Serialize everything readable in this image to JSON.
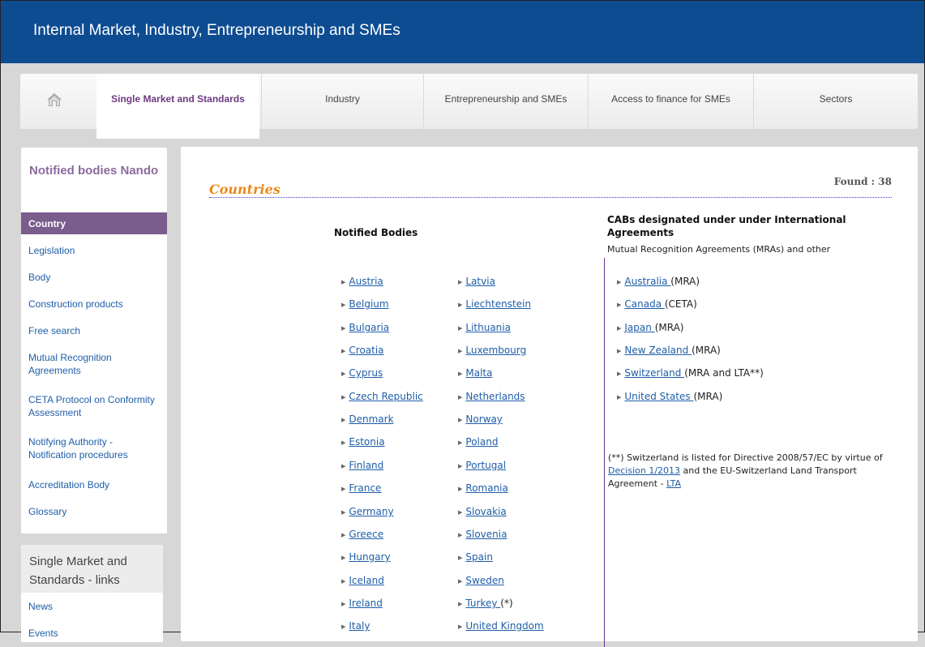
{
  "header": {
    "title": "Internal Market, Industry, Entrepreneurship and SMEs"
  },
  "nav": {
    "home_icon": "home-icon",
    "items": [
      {
        "label": "Single Market and Standards",
        "active": true
      },
      {
        "label": "Industry"
      },
      {
        "label": "Entrepreneurship and SMEs"
      },
      {
        "label": "Access to finance for SMEs"
      },
      {
        "label": "Sectors"
      }
    ]
  },
  "sidebar": {
    "title": "Notified bodies Nando",
    "items": [
      {
        "label": "Country",
        "active": true
      },
      {
        "label": "Legislation"
      },
      {
        "label": "Body"
      },
      {
        "label": "Construction products"
      },
      {
        "label": "Free search"
      },
      {
        "label": "Mutual Recognition Agreements"
      },
      {
        "label": "CETA Protocol on Conformity Assessment"
      },
      {
        "label": "Notifying Authority - Notification procedures"
      },
      {
        "label": "Accreditation Body"
      },
      {
        "label": "Glossary"
      }
    ],
    "links_box": {
      "title": "Single Market and Standards - links",
      "items": [
        {
          "label": "News"
        },
        {
          "label": "Events"
        }
      ]
    }
  },
  "main": {
    "heading": "Countries",
    "found": "Found : 38",
    "notified_bodies_header": "Notified Bodies",
    "col1": [
      "Austria",
      "Belgium",
      "Bulgaria",
      "Croatia",
      "Cyprus",
      "Czech Republic",
      "Denmark",
      "Estonia",
      "Finland",
      "France",
      "Germany",
      "Greece",
      "Hungary",
      "Iceland",
      "Ireland",
      "Italy"
    ],
    "col2": [
      "Latvia",
      "Liechtenstein",
      "Lithuania",
      "Luxembourg",
      "Malta",
      "Netherlands",
      "Norway",
      "Poland",
      "Portugal",
      "Romania",
      "Slovakia",
      "Slovenia",
      "Spain",
      "Sweden",
      "Turkey ",
      "United Kingdom"
    ],
    "col2_notes": {
      "14": "(*)"
    },
    "cab_title": "CABs designated under under International Agreements",
    "cab_subtitle": "Mutual Recognition Agreements (MRAs) and other",
    "cab_list": [
      {
        "link": "Australia ",
        "note": "(MRA)"
      },
      {
        "link": "Canada ",
        "note": "(CETA)"
      },
      {
        "link": "Japan ",
        "note": "(MRA)"
      },
      {
        "link": "New Zealand ",
        "note": "(MRA)"
      },
      {
        "link": "Switzerland ",
        "note": "(MRA and LTA**)"
      },
      {
        "link": "United States ",
        "note": "(MRA)"
      }
    ],
    "footnote": {
      "part1": "(**) Switzerland is listed for Directive 2008/57/EC by virtue of ",
      "link1": "Decision 1/2013",
      "part2": " and the EU-Switzerland Land Transport Agreement - ",
      "link2": "LTA"
    }
  }
}
